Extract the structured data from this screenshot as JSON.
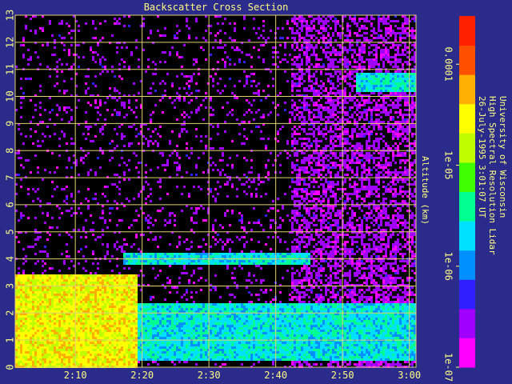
{
  "chart_data": {
    "type": "heatmap",
    "title": "Backscatter Cross Section",
    "ylabel": "Altitude (km)",
    "ylim": [
      0,
      13
    ],
    "yticks": [
      "0",
      "1",
      "2",
      "3",
      "4",
      "5",
      "6",
      "7",
      "8",
      "9",
      "10",
      "11",
      "12",
      "13"
    ],
    "xlim_minutes": [
      121,
      181
    ],
    "xticks": [
      {
        "label": "2:10",
        "minutes": 130
      },
      {
        "label": "2:20",
        "minutes": 140
      },
      {
        "label": "2:30",
        "minutes": 150
      },
      {
        "label": "2:40",
        "minutes": 160
      },
      {
        "label": "2:50",
        "minutes": 170
      },
      {
        "label": "3:00",
        "minutes": 180
      }
    ],
    "grid": true,
    "colorbar": {
      "scale": "log",
      "range": [
        1e-07,
        0.0003
      ],
      "ticks": [
        "0.0001",
        "1e-05",
        "1e-06",
        "1e-07"
      ],
      "tick_values": [
        0.0001,
        1e-05,
        1e-06,
        1e-07
      ],
      "colormap": [
        "#ff00ff",
        "#a000ff",
        "#3020ff",
        "#0090ff",
        "#00e0ff",
        "#00ff90",
        "#40ff00",
        "#c0ff00",
        "#ffff00",
        "#ffb000",
        "#ff5000",
        "#ff2000"
      ]
    },
    "features": [
      {
        "name": "boundary-layer aerosol",
        "x_minutes": [
          121,
          139
        ],
        "altitude_km": [
          0,
          3.5
        ],
        "level": "high"
      },
      {
        "name": "aerosol layer",
        "x_minutes": [
          121,
          181
        ],
        "altitude_km": [
          0.3,
          2.4
        ],
        "level": "medium"
      },
      {
        "name": "cloud base layer",
        "x_minutes": [
          137,
          165
        ],
        "altitude_km": [
          3.8,
          4.3
        ],
        "level": "medium"
      },
      {
        "name": "cirrus",
        "x_minutes": [
          172,
          181
        ],
        "altitude_km": [
          10.2,
          10.9
        ],
        "level": "medium"
      }
    ]
  },
  "credit": [
    "University of Wisconsin",
    "High Spectral Resolution Lidar",
    "26-July-1995  3:01:07 UT"
  ],
  "colors": {
    "background": "#2b2b8c",
    "grid": "#e0d070",
    "text": "#ffff80"
  }
}
